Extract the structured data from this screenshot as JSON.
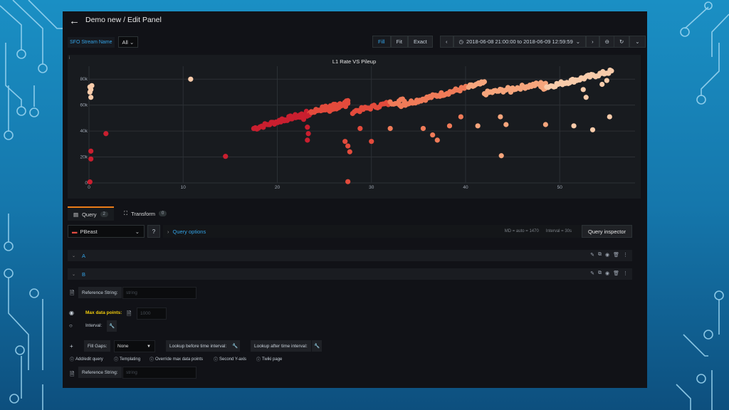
{
  "header": {
    "back_icon": "arrow-left-icon",
    "title": "Demo new / Edit Panel"
  },
  "variables": {
    "stream_label": "SFO Stream Name",
    "stream_value": "All"
  },
  "toolbar": {
    "fill": "Fill",
    "fit": "Fit",
    "exact": "Exact",
    "time_range": "2018-06-08 21:00:00 to 2018-06-09 12:59:59"
  },
  "panel": {
    "title": "L1 Rate VS Pileup",
    "info": "i"
  },
  "chart_data": {
    "type": "scatter",
    "title": "L1 Rate VS Pileup",
    "xlabel": "",
    "ylabel": "",
    "x_ticks": [
      0,
      10,
      20,
      30,
      40,
      50
    ],
    "y_ticks": [
      "0",
      "20k",
      "40k",
      "60k",
      "80k"
    ],
    "xlim": [
      0,
      58
    ],
    "ylim": [
      0,
      90000
    ],
    "grid": true,
    "color_scale": [
      "#c91f2f",
      "#e34b3c",
      "#ef7b58",
      "#f6a57c",
      "#f8cbaa"
    ],
    "points": [
      [
        0.1,
        74000
      ],
      [
        0.1,
        70000
      ],
      [
        0.2,
        66000
      ],
      [
        0.3,
        75000
      ],
      [
        0.2,
        72000
      ],
      [
        0.1,
        800
      ],
      [
        0.2,
        24500
      ],
      [
        0.2,
        18500
      ],
      [
        1.8,
        38000
      ],
      [
        10.8,
        80000
      ],
      [
        14.5,
        20500
      ],
      [
        22.8,
        49000
      ],
      [
        23.2,
        43000
      ],
      [
        23.3,
        38000
      ],
      [
        23.2,
        33000
      ],
      [
        27.2,
        32000
      ],
      [
        27.5,
        28500
      ],
      [
        27.7,
        24000
      ],
      [
        27.5,
        1000
      ],
      [
        28.8,
        42000
      ],
      [
        30.0,
        32000
      ],
      [
        32.0,
        42000
      ],
      [
        35.5,
        42000
      ],
      [
        36.5,
        37000
      ],
      [
        37.0,
        33000
      ],
      [
        38.3,
        44000
      ],
      [
        39.5,
        51000
      ],
      [
        41.3,
        44000
      ],
      [
        43.7,
        51000
      ],
      [
        44.3,
        45000
      ],
      [
        43.8,
        21000
      ],
      [
        48.5,
        45000
      ],
      [
        51.5,
        44000
      ],
      [
        53.5,
        41000
      ],
      [
        55.3,
        51000
      ],
      [
        52.5,
        72000
      ],
      [
        54.5,
        76000
      ],
      [
        55.0,
        79000
      ],
      [
        52.8,
        66000
      ],
      [
        44.8,
        70000
      ]
    ],
    "bands": [
      {
        "x0": 17.5,
        "y0": 42000,
        "x1": 27.5,
        "y1": 63000,
        "n": 60
      },
      {
        "x0": 20.5,
        "y0": 48000,
        "x1": 27.5,
        "y1": 60000,
        "n": 30
      },
      {
        "x0": 28.0,
        "y0": 55000,
        "x1": 33.5,
        "y1": 64000,
        "n": 30
      },
      {
        "x0": 33.0,
        "y0": 60000,
        "x1": 42.0,
        "y1": 77000,
        "n": 60
      },
      {
        "x0": 42.0,
        "y0": 69000,
        "x1": 48.5,
        "y1": 77000,
        "n": 40
      },
      {
        "x0": 48.0,
        "y0": 73000,
        "x1": 55.5,
        "y1": 86000,
        "n": 50
      }
    ]
  },
  "tabs": [
    {
      "label": "Query",
      "count": "2",
      "icon": "database-icon"
    },
    {
      "label": "Transform",
      "count": "0",
      "icon": "transform-icon"
    }
  ],
  "query": {
    "datasource": "PBeast",
    "options": "Query options",
    "meta_md": "MD = auto = 1470",
    "meta_interval": "Interval = 30s",
    "inspector": "Query inspector"
  },
  "queries": [
    {
      "ref": "A"
    },
    {
      "ref": "B",
      "reference_string_label": "Reference String:",
      "reference_string_placeholder": "string",
      "max_points_label": "Max data points:",
      "max_points_placeholder": "1000",
      "interval_label": "Interval:",
      "fill_gaps_label": "Fill Gaps:",
      "fill_gaps_value": "None",
      "lookup_before": "Lookup before time interval:",
      "lookup_after": "Lookup after time interval:",
      "links": [
        "Add/edit query",
        "Templating",
        "Override max data points",
        "Second Y-axis",
        "Twiki page"
      ],
      "reference_string2_label": "Reference String:",
      "reference_string2_placeholder": "string"
    }
  ]
}
